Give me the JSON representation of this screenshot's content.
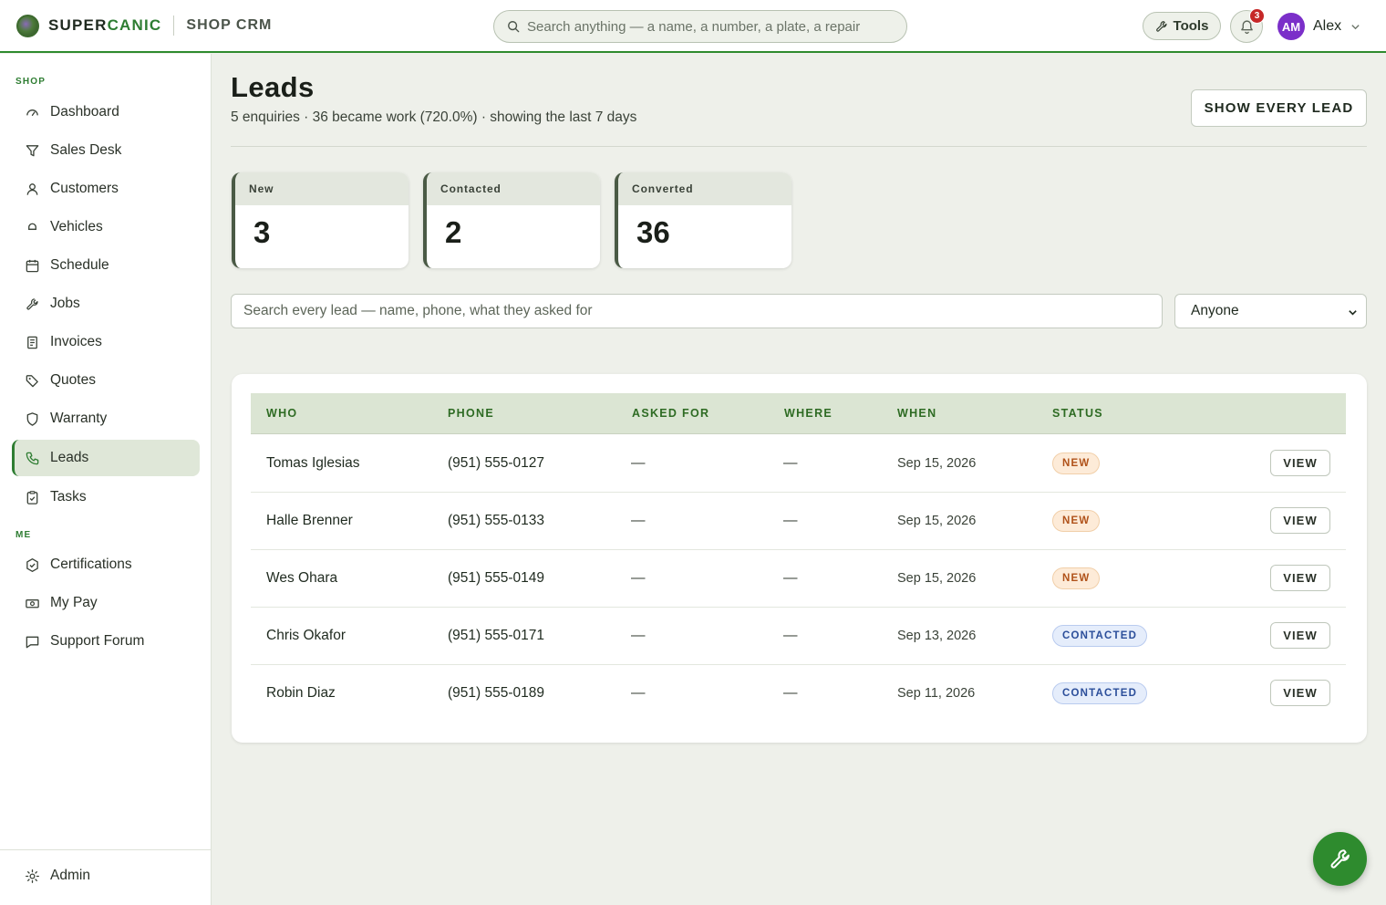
{
  "brand": {
    "name_part1": "SUPER",
    "name_part2": "CANIC",
    "subtitle": "SHOP CRM"
  },
  "header": {
    "search_placeholder": "Search anything — a name, a number, a plate, a repair",
    "tools_label": "Tools",
    "notification_count": "3",
    "user_initials": "AM",
    "user_name": "Alex"
  },
  "sidebar": {
    "section_shop": "SHOP",
    "section_me": "ME",
    "items": [
      {
        "label": "Dashboard",
        "icon": "gauge-icon"
      },
      {
        "label": "Sales Desk",
        "icon": "funnel-icon"
      },
      {
        "label": "Customers",
        "icon": "person-icon"
      },
      {
        "label": "Vehicles",
        "icon": "car-icon"
      },
      {
        "label": "Schedule",
        "icon": "calendar-icon"
      },
      {
        "label": "Jobs",
        "icon": "wrench-icon"
      },
      {
        "label": "Invoices",
        "icon": "receipt-icon"
      },
      {
        "label": "Quotes",
        "icon": "tag-icon"
      },
      {
        "label": "Warranty",
        "icon": "shield-icon"
      },
      {
        "label": "Leads",
        "icon": "phone-icon",
        "active": true
      },
      {
        "label": "Tasks",
        "icon": "clipboard-check-icon"
      }
    ],
    "me_items": [
      {
        "label": "Certifications",
        "icon": "badge-icon"
      },
      {
        "label": "My Pay",
        "icon": "cash-icon"
      },
      {
        "label": "Support Forum",
        "icon": "chat-icon"
      }
    ],
    "admin_label": "Admin"
  },
  "page": {
    "title": "Leads",
    "subtitle": "5 enquiries · 36 became work (720.0%) · showing the last 7 days",
    "show_every_label": "SHOW EVERY LEAD"
  },
  "stats": [
    {
      "label": "New",
      "value": "3"
    },
    {
      "label": "Contacted",
      "value": "2"
    },
    {
      "label": "Converted",
      "value": "36"
    }
  ],
  "filters": {
    "search_placeholder": "Search every lead — name, phone, what they asked for",
    "owner_selected": "Anyone"
  },
  "table": {
    "columns": [
      "WHO",
      "PHONE",
      "ASKED FOR",
      "WHERE",
      "WHEN",
      "STATUS"
    ],
    "view_label": "VIEW",
    "rows": [
      {
        "who": "Tomas Iglesias",
        "phone": "(951) 555-0127",
        "asked_for": "—",
        "where": "—",
        "when": "Sep 15, 2026",
        "status": "NEW"
      },
      {
        "who": "Halle Brenner",
        "phone": "(951) 555-0133",
        "asked_for": "—",
        "where": "—",
        "when": "Sep 15, 2026",
        "status": "NEW"
      },
      {
        "who": "Wes Ohara",
        "phone": "(951) 555-0149",
        "asked_for": "—",
        "where": "—",
        "when": "Sep 15, 2026",
        "status": "NEW"
      },
      {
        "who": "Chris Okafor",
        "phone": "(951) 555-0171",
        "asked_for": "—",
        "where": "—",
        "when": "Sep 13, 2026",
        "status": "CONTACTED"
      },
      {
        "who": "Robin Diaz",
        "phone": "(951) 555-0189",
        "asked_for": "—",
        "where": "—",
        "when": "Sep 11, 2026",
        "status": "CONTACTED"
      }
    ]
  },
  "colors": {
    "brand_green": "#2e7d32",
    "new_badge": "#b0521a",
    "contacted_badge": "#2b4e9a",
    "avatar": "#7b2fc9"
  }
}
